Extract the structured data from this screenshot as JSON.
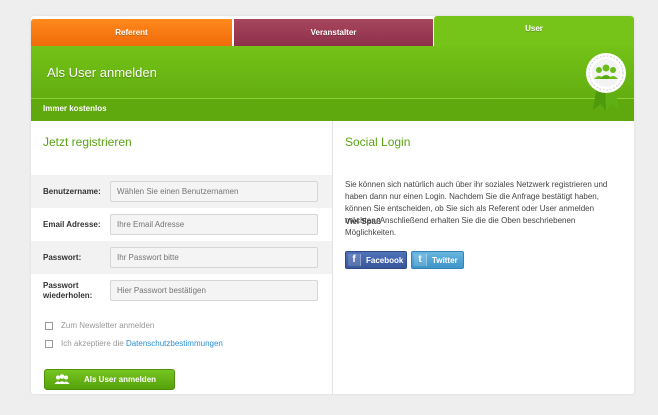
{
  "tabs": [
    {
      "label": "Referent",
      "color": "#f57a12"
    },
    {
      "label": "Veranstalter",
      "color": "#9a3b53"
    },
    {
      "label": "User",
      "color": "#76c41a"
    }
  ],
  "banner": {
    "title": "Als User anmelden",
    "subtitle": "Immer kostenlos",
    "seal_icon": "users-icon"
  },
  "register": {
    "title": "Jetzt registrieren",
    "fields": [
      {
        "label": "Benutzername:",
        "placeholder": "Wählen Sie einen Benutzernamen"
      },
      {
        "label": "Email Adresse:",
        "placeholder": "Ihre Email Adresse"
      },
      {
        "label": "Passwort:",
        "placeholder": "Ihr Passwort bitte"
      },
      {
        "label_line1": "Passwort",
        "label_line2": "wiederholen:",
        "placeholder": "Hier Passwort bestätigen"
      }
    ],
    "newsletter": "Zum Newsletter anmelden",
    "terms_prefix": "Ich akzeptiere die",
    "terms_link": "Datenschutzbestimmungen",
    "submit": "Als User anmelden"
  },
  "social": {
    "title": "Social Login",
    "text": "Sie können sich natürlich auch über ihr soziales Netzwerk registrieren und haben dann nur einen Login. Nachdem Sie die Anfrage bestätigt haben, können Sie entscheiden, ob Sie sich als Referent oder User anmelden möchten. Anschließend erhalten Sie die die Oben beschriebenen Möglichkeiten.",
    "closing": "Viel Spaß",
    "facebook": "Facebook",
    "twitter": "Twitter"
  }
}
